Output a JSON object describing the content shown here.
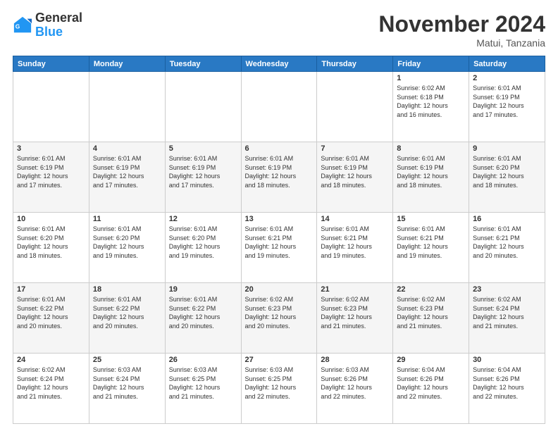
{
  "header": {
    "logo_line1": "General",
    "logo_line2": "Blue",
    "month_title": "November 2024",
    "location": "Matui, Tanzania"
  },
  "days_of_week": [
    "Sunday",
    "Monday",
    "Tuesday",
    "Wednesday",
    "Thursday",
    "Friday",
    "Saturday"
  ],
  "weeks": [
    [
      {
        "day": "",
        "info": ""
      },
      {
        "day": "",
        "info": ""
      },
      {
        "day": "",
        "info": ""
      },
      {
        "day": "",
        "info": ""
      },
      {
        "day": "",
        "info": ""
      },
      {
        "day": "1",
        "info": "Sunrise: 6:02 AM\nSunset: 6:18 PM\nDaylight: 12 hours\nand 16 minutes."
      },
      {
        "day": "2",
        "info": "Sunrise: 6:01 AM\nSunset: 6:19 PM\nDaylight: 12 hours\nand 17 minutes."
      }
    ],
    [
      {
        "day": "3",
        "info": "Sunrise: 6:01 AM\nSunset: 6:19 PM\nDaylight: 12 hours\nand 17 minutes."
      },
      {
        "day": "4",
        "info": "Sunrise: 6:01 AM\nSunset: 6:19 PM\nDaylight: 12 hours\nand 17 minutes."
      },
      {
        "day": "5",
        "info": "Sunrise: 6:01 AM\nSunset: 6:19 PM\nDaylight: 12 hours\nand 17 minutes."
      },
      {
        "day": "6",
        "info": "Sunrise: 6:01 AM\nSunset: 6:19 PM\nDaylight: 12 hours\nand 18 minutes."
      },
      {
        "day": "7",
        "info": "Sunrise: 6:01 AM\nSunset: 6:19 PM\nDaylight: 12 hours\nand 18 minutes."
      },
      {
        "day": "8",
        "info": "Sunrise: 6:01 AM\nSunset: 6:19 PM\nDaylight: 12 hours\nand 18 minutes."
      },
      {
        "day": "9",
        "info": "Sunrise: 6:01 AM\nSunset: 6:20 PM\nDaylight: 12 hours\nand 18 minutes."
      }
    ],
    [
      {
        "day": "10",
        "info": "Sunrise: 6:01 AM\nSunset: 6:20 PM\nDaylight: 12 hours\nand 18 minutes."
      },
      {
        "day": "11",
        "info": "Sunrise: 6:01 AM\nSunset: 6:20 PM\nDaylight: 12 hours\nand 19 minutes."
      },
      {
        "day": "12",
        "info": "Sunrise: 6:01 AM\nSunset: 6:20 PM\nDaylight: 12 hours\nand 19 minutes."
      },
      {
        "day": "13",
        "info": "Sunrise: 6:01 AM\nSunset: 6:21 PM\nDaylight: 12 hours\nand 19 minutes."
      },
      {
        "day": "14",
        "info": "Sunrise: 6:01 AM\nSunset: 6:21 PM\nDaylight: 12 hours\nand 19 minutes."
      },
      {
        "day": "15",
        "info": "Sunrise: 6:01 AM\nSunset: 6:21 PM\nDaylight: 12 hours\nand 19 minutes."
      },
      {
        "day": "16",
        "info": "Sunrise: 6:01 AM\nSunset: 6:21 PM\nDaylight: 12 hours\nand 20 minutes."
      }
    ],
    [
      {
        "day": "17",
        "info": "Sunrise: 6:01 AM\nSunset: 6:22 PM\nDaylight: 12 hours\nand 20 minutes."
      },
      {
        "day": "18",
        "info": "Sunrise: 6:01 AM\nSunset: 6:22 PM\nDaylight: 12 hours\nand 20 minutes."
      },
      {
        "day": "19",
        "info": "Sunrise: 6:01 AM\nSunset: 6:22 PM\nDaylight: 12 hours\nand 20 minutes."
      },
      {
        "day": "20",
        "info": "Sunrise: 6:02 AM\nSunset: 6:23 PM\nDaylight: 12 hours\nand 20 minutes."
      },
      {
        "day": "21",
        "info": "Sunrise: 6:02 AM\nSunset: 6:23 PM\nDaylight: 12 hours\nand 21 minutes."
      },
      {
        "day": "22",
        "info": "Sunrise: 6:02 AM\nSunset: 6:23 PM\nDaylight: 12 hours\nand 21 minutes."
      },
      {
        "day": "23",
        "info": "Sunrise: 6:02 AM\nSunset: 6:24 PM\nDaylight: 12 hours\nand 21 minutes."
      }
    ],
    [
      {
        "day": "24",
        "info": "Sunrise: 6:02 AM\nSunset: 6:24 PM\nDaylight: 12 hours\nand 21 minutes."
      },
      {
        "day": "25",
        "info": "Sunrise: 6:03 AM\nSunset: 6:24 PM\nDaylight: 12 hours\nand 21 minutes."
      },
      {
        "day": "26",
        "info": "Sunrise: 6:03 AM\nSunset: 6:25 PM\nDaylight: 12 hours\nand 21 minutes."
      },
      {
        "day": "27",
        "info": "Sunrise: 6:03 AM\nSunset: 6:25 PM\nDaylight: 12 hours\nand 22 minutes."
      },
      {
        "day": "28",
        "info": "Sunrise: 6:03 AM\nSunset: 6:26 PM\nDaylight: 12 hours\nand 22 minutes."
      },
      {
        "day": "29",
        "info": "Sunrise: 6:04 AM\nSunset: 6:26 PM\nDaylight: 12 hours\nand 22 minutes."
      },
      {
        "day": "30",
        "info": "Sunrise: 6:04 AM\nSunset: 6:26 PM\nDaylight: 12 hours\nand 22 minutes."
      }
    ]
  ]
}
